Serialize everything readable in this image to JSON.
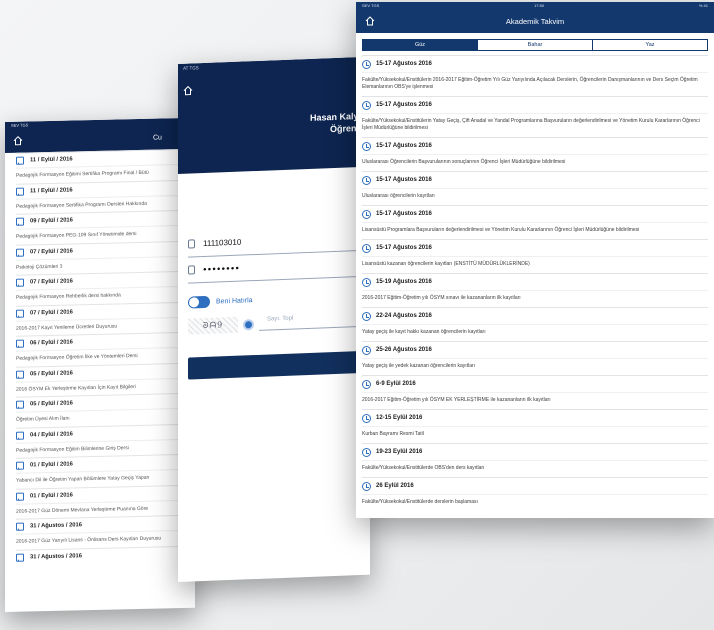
{
  "left_screen": {
    "status": "SEV TGS",
    "title_partial": "Cu",
    "items": [
      {
        "date": "11 / Eylül / 2016",
        "text": "Pedagojik Formasyon Eğitimi Sertifika Programı Final / Bütü"
      },
      {
        "date": "11 / Eylül / 2016",
        "text": "Pedagojik Formasyon Sertifika Programı Dersleri Hakkında"
      },
      {
        "date": "09 / Eylül / 2016",
        "text": "Pedagojik Formasyon PEG-109 Sınıf Yönetimide dersi"
      },
      {
        "date": "07 / Eylül / 2016",
        "text": "Psikoloji Çözümleri 3"
      },
      {
        "date": "07 / Eylül / 2016",
        "text": "Pedagojik Formasyon Rehberlik dersi hakkında"
      },
      {
        "date": "07 / Eylül / 2016",
        "text": "2016-2017 Kayıt Yenileme Ücretleri Duyurusu"
      },
      {
        "date": "06 / Eylül / 2016",
        "text": "Pedagojik Formasyon Öğretim İlke ve Yöntemleri Dersi"
      },
      {
        "date": "05 / Eylül / 2016",
        "text": "2016 ÖSYM Ek Yerleştirme Kayıtları İçin Kayıt Bilgileri"
      },
      {
        "date": "05 / Eylül / 2016",
        "text": "Öğretim Üyesi Alım İlanı"
      },
      {
        "date": "04 / Eylül / 2016",
        "text": "Pedagojik Formasyon Eğitim Bilimlerine Giriş Dersi"
      },
      {
        "date": "01 / Eylül / 2016",
        "text": "Yabancı Dil ile Öğretim Yapan Bölümlere Yatay Geçiş Yapan"
      },
      {
        "date": "01 / Eylül / 2016",
        "text": "2016-2017 Güz Dönemi Mevlana Yerleştirme Puanına Göre"
      },
      {
        "date": "31 / Ağustos / 2016",
        "text": "2016-2017 Güz Yarıyılı Lisans - Önlisans Ders Kayıtları Duyurusu"
      },
      {
        "date": "31 / Ağustos / 2016",
        "text": ""
      }
    ]
  },
  "middle_screen": {
    "status": "AT TGS",
    "university_line1": "Hasan Kalyo",
    "university_line2": "Öğrenci",
    "student_no": "111103010",
    "password_mask": "●●●●●●●●",
    "remember_label": "Beni Hatırla",
    "captcha_text": "ᘐᗩ9",
    "captcha_placeholder": "Sayı. Topl"
  },
  "right_screen": {
    "status_left": "SEV TGS",
    "status_center": "17:50",
    "status_right": "% 41",
    "title": "Akademik Takvim",
    "tabs": [
      "Güz",
      "Bahar",
      "Yaz"
    ],
    "active_tab": 0,
    "events": [
      {
        "date": "15-17 Ağustos 2016",
        "text": "Fakülte/Yüksekokul/Enstitülerin 2016-2017 Eğitim-Öğretim Yılı Güz Yarıyılında Açılacak Derslerin, Öğrencilerin Danışmanlarının ve Ders Seçim Öğretim Elemanlarının OBS'ye işlenmesi"
      },
      {
        "date": "15-17 Ağustos 2016",
        "text": "Fakülte/Yüksekokul/Enstitülerin Yatay Geçiş, Çift Anadal ve Yandal Programlarına Başvuruların değerlendirilmesi ve Yönetim Kurulu Kararlarının Öğrenci İşleri Müdürlüğüne bildirilmesi"
      },
      {
        "date": "15-17 Ağustos 2016",
        "text": "Uluslararası Öğrencilerin Başvurularının sonuçlarının Öğrenci İşleri Müdürlüğüne bildirilmesi"
      },
      {
        "date": "15-17 Ağustos 2016",
        "text": "Uluslararası öğrencilerin kayıtları"
      },
      {
        "date": "15-17 Ağustos 2016",
        "text": "Lisansüstü Programlara Başvuruların değerlendirilmesi ve Yönetim Kurulu Kararlarının Öğrenci İşleri Müdürlüğüne bildirilmesi"
      },
      {
        "date": "15-17 Ağustos 2016",
        "text": "Lisansüstü kazanan öğrencilerin kayıtları (ENSTİTÜ MÜDÜRLÜKLERİNDE)"
      },
      {
        "date": "15-19 Ağustos 2016",
        "text": "2016-2017 Eğitim-Öğretim yılı ÖSYM sınavı ile kazananların ilk kayıtları"
      },
      {
        "date": "22-24 Ağustos 2016",
        "text": "Yatay geçiş ile kayıt hakkı kazanan öğrencilerin kayıtları"
      },
      {
        "date": "25-26 Ağustos 2016",
        "text": "Yatay geçiş ile yedek kazanan öğrencilerin kayıtları"
      },
      {
        "date": "6-9 Eylül 2016",
        "text": "2016-2017 Eğitim-Öğretim yılı ÖSYM EK YERLEŞTİRME ile kazananların ilk kayıtları"
      },
      {
        "date": "12-15 Eylül 2016",
        "text": "Kurban Bayramı Resmi Tatil"
      },
      {
        "date": "19-23 Eylül 2016",
        "text": "Fakülte/Yüksekokul/Enstitülerde OBS'den ders kayıtları"
      },
      {
        "date": "26 Eylül 2016",
        "text": "Fakülte/Yüksekokul/Enstitülerde derslerin başlaması"
      }
    ]
  },
  "colors": {
    "navy": "#0d2550",
    "accent": "#2f6fc0",
    "header": "#12386e"
  }
}
